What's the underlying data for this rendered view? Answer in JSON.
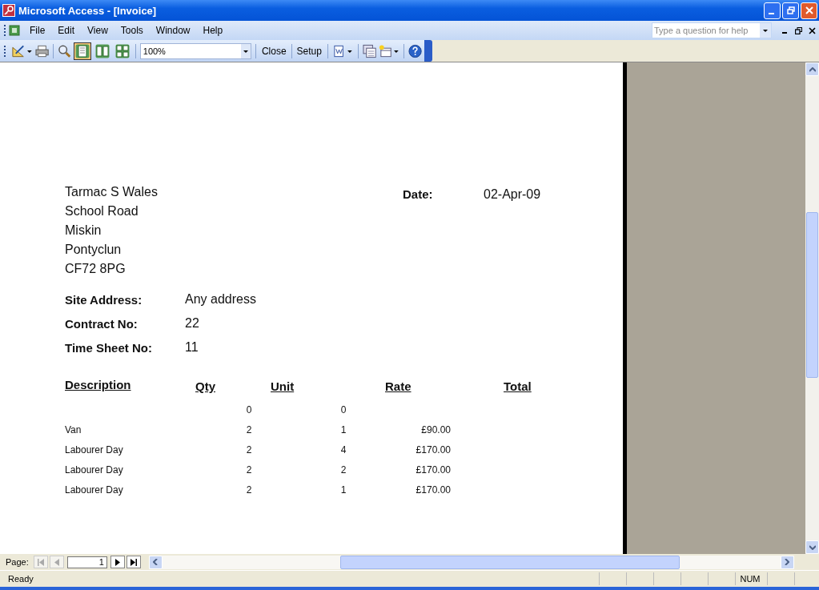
{
  "window": {
    "title": "Microsoft Access - [Invoice]"
  },
  "menu": {
    "items": [
      "File",
      "Edit",
      "View",
      "Tools",
      "Window",
      "Help"
    ],
    "help_box": {
      "placeholder": "Type a question for help"
    }
  },
  "toolbar": {
    "view_buttons": [
      {
        "kind": "one",
        "selected": true
      },
      {
        "kind": "two",
        "selected": false
      },
      {
        "kind": "multi",
        "selected": false
      }
    ],
    "zoom": "100%",
    "buttons": [
      "Close",
      "Setup"
    ]
  },
  "report": {
    "address": [
      "Tarmac S Wales",
      "School Road",
      "Miskin",
      "Pontyclun",
      "CF72 8PG"
    ],
    "date": {
      "label": "Date:",
      "value": "02-Apr-09"
    },
    "fields": [
      {
        "label": "Site Address:",
        "value": "Any address"
      },
      {
        "label": "Contract No:",
        "value": "22"
      },
      {
        "label": "Time Sheet No:",
        "value": "11"
      }
    ],
    "columns": [
      "Description",
      "Qty",
      "Unit",
      "Rate",
      "Total"
    ],
    "rows": [
      {
        "qty": "0",
        "unit": "0"
      },
      {
        "description": "Van",
        "qty": "2",
        "unit": "1",
        "rate": "£90.00"
      },
      {
        "description": "Labourer Day",
        "qty": "2",
        "unit": "4",
        "rate": "£170.00"
      },
      {
        "description": "Labourer Day",
        "qty": "2",
        "unit": "2",
        "rate": "£170.00"
      },
      {
        "description": "Labourer Day",
        "qty": "2",
        "unit": "1",
        "rate": "£170.00"
      }
    ]
  },
  "navigation": {
    "label": "Page:",
    "page": "1"
  },
  "status_bar": {
    "text": "Ready",
    "indicator": "NUM"
  }
}
